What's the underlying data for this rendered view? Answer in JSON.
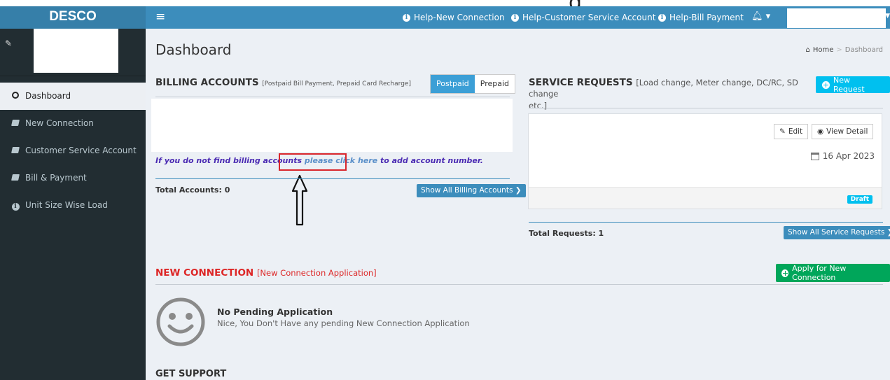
{
  "header": {
    "brand": "DESCO",
    "menu_icon": "hamburger-icon",
    "nav": [
      {
        "label": "Help-New Connection",
        "icon": "info-icon"
      },
      {
        "label": "Help-Customer Service Account",
        "icon": "info-icon"
      },
      {
        "label": "Help-Bill Payment",
        "icon": "info-icon"
      }
    ],
    "bell_icon": "bell-icon",
    "accent": "#3c8dbc"
  },
  "sidebar": {
    "items": [
      {
        "label": "Dashboard",
        "icon": "circle-icon",
        "active": true
      },
      {
        "label": "New Connection",
        "icon": "book-icon"
      },
      {
        "label": "Customer Service Account",
        "icon": "book-icon"
      },
      {
        "label": "Bill & Payment",
        "icon": "book-icon"
      },
      {
        "label": "Unit Size Wise Load",
        "icon": "info-icon"
      }
    ]
  },
  "page": {
    "title": "Dashboard",
    "breadcrumb": {
      "home": "Home",
      "sep": ">",
      "current": "Dashboard"
    }
  },
  "billing": {
    "title": "BILLING ACCOUNTS",
    "subtitle": "[Postpaid Bill Payment, Prepaid Card Recharge]",
    "tabs": [
      {
        "label": "Postpaid",
        "active": true
      },
      {
        "label": "Prepaid"
      }
    ],
    "hint_before": "If you do not find billing accounts",
    "hint_link": "please click here",
    "hint_after": "to add account number.",
    "total": "Total Accounts: 0",
    "show_all": "Show All Billing Accounts ❯"
  },
  "service": {
    "title": "SERVICE REQUESTS",
    "subtitle_1": "[Load change, Meter change, DC/RC, SD change",
    "subtitle_2": "etc.]",
    "new_request": "New Request",
    "edit": "Edit",
    "view_detail": "View Detail",
    "date": "16 Apr 2023",
    "status": "Draft",
    "total": "Total Requests: 1",
    "show_all": "Show All Service Requests ❯"
  },
  "new_connection": {
    "title": "NEW CONNECTION",
    "subtitle": "[New Connection Application]",
    "apply": "Apply for New Connection",
    "empty_title": "No Pending Application",
    "empty_sub": "Nice, You Don't Have any pending New Connection Application"
  },
  "support": {
    "title": "GET SUPPORT"
  },
  "overlay_glyph": "g"
}
